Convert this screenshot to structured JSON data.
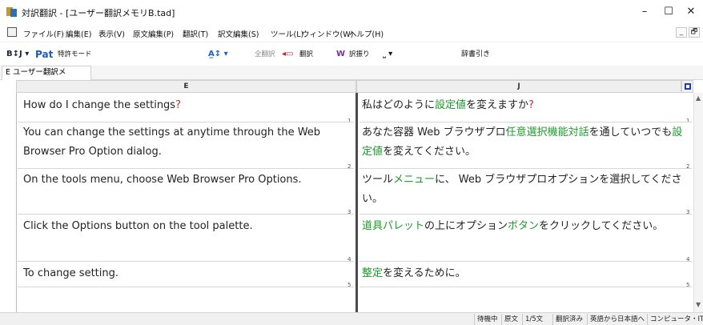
{
  "window": {
    "title": "対訳翻訳 - [ユーザー翻訳メモリB.tad]",
    "minimize": "–",
    "maximize": "☐",
    "close": "✕"
  },
  "menubar": {
    "items": [
      "ファイル(F)",
      "編集(E)",
      "表示(V)",
      "原文編集(P)",
      "翻訳(T)",
      "訳文編集(S)",
      "ツール(L)",
      "ウィンドウ(W)",
      "ヘルプ(H)"
    ],
    "mdi_minimize": "_",
    "mdi_restore": "🗗"
  },
  "toolbar": {
    "bj": "B↕J ▾",
    "pat": "Pat",
    "patent_mode": "特許モード",
    "translate_all": "全翻訳",
    "translate": "翻訳",
    "dict_pull": "辞書引き",
    "bilingual": "訳振り"
  },
  "tab": {
    "label": "E ユーザー翻訳メ"
  },
  "columns": {
    "left": "E",
    "right": "J"
  },
  "rows": [
    {
      "number": "1",
      "en": "How do I change the settings?",
      "ja_parts": [
        {
          "t": "私はどのように"
        },
        {
          "t": "設定値",
          "c": "green"
        },
        {
          "t": "を変えますか"
        },
        {
          "t": "?",
          "c": "red"
        }
      ],
      "en_parts": [
        {
          "t": "How do I change the settings"
        },
        {
          "t": "?",
          "c": "red"
        }
      ]
    },
    {
      "number": "2",
      "en": "You can change the settings at anytime through the Web Browser Pro Option dialog.",
      "ja_parts": [
        {
          "t": "あなた容器 Web ブラウザプロ"
        },
        {
          "t": "任意選択機能対話",
          "c": "green"
        },
        {
          "t": "を通していつでも"
        },
        {
          "t": "設定値",
          "c": "green"
        },
        {
          "t": "を変えてください。"
        }
      ]
    },
    {
      "number": "3",
      "en": "On the tools menu, choose Web Browser Pro Options.",
      "ja_parts": [
        {
          "t": "ツール"
        },
        {
          "t": "メニュー",
          "c": "green"
        },
        {
          "t": "に、 Web ブラウザプロオプションを選択してください。"
        }
      ]
    },
    {
      "number": "4",
      "en": "Click the Options button on the tool palette.",
      "ja_parts": [
        {
          "t": "道具パレット",
          "c": "green"
        },
        {
          "t": "の上にオプション"
        },
        {
          "t": "ボタン",
          "c": "green"
        },
        {
          "t": "をクリックしてください。"
        }
      ]
    },
    {
      "number": "5",
      "en": "To change setting.",
      "ja_parts": [
        {
          "t": "整定",
          "c": "green"
        },
        {
          "t": "を変えるために。"
        }
      ]
    }
  ],
  "status": {
    "state": "待機中",
    "mode": "原文",
    "count": "1/5文",
    "translated": "翻訳済み",
    "direction": "英語から日本語へ",
    "field": "コンピュータ・IT"
  },
  "colors": {
    "accent_green": "#1c9a2c",
    "accent_red": "#d62828",
    "divider": "#4a4a4a"
  }
}
